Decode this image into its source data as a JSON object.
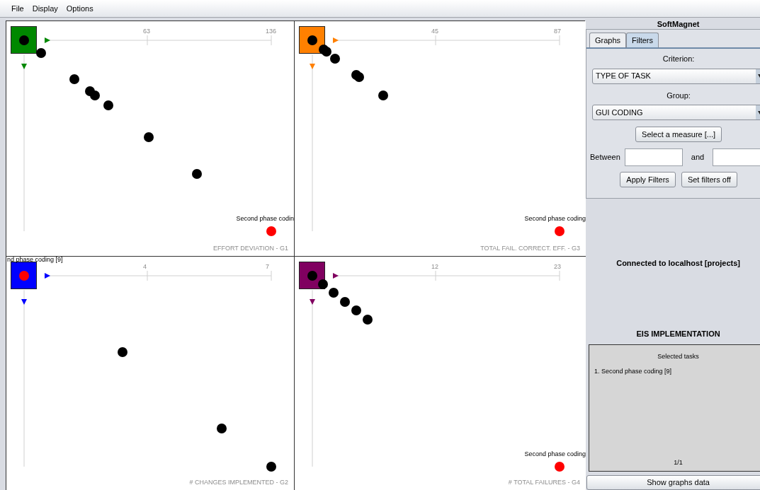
{
  "menu": [
    "File",
    "Display",
    "Options"
  ],
  "graphs": [
    {
      "title": "EFFORT DEVIATION - G1",
      "color": "#008800",
      "ticks": [
        "63",
        "136"
      ],
      "highlight_label": "Second phase codin",
      "highlight_in_square": false
    },
    {
      "title": "TOTAL FAIL. CORRECT. EFF. - G3",
      "color": "#ff8000",
      "ticks": [
        "45",
        "87"
      ],
      "highlight_label": "Second phase coding",
      "highlight_in_square": false
    },
    {
      "title": "# CHANGES IMPLEMENTED - G2",
      "color": "#0000ff",
      "ticks": [
        "4",
        "7"
      ],
      "highlight_label": "nd phase coding [9]",
      "highlight_in_square": true
    },
    {
      "title": "# TOTAL FAILURES - G4",
      "color": "#800060",
      "ticks": [
        "12",
        "23"
      ],
      "highlight_label": "Second phase coding",
      "highlight_in_square": false
    }
  ],
  "side": {
    "title": "SoftMagnet",
    "tabs": [
      {
        "label": "Graphs",
        "selected": false
      },
      {
        "label": "Filters",
        "selected": true
      }
    ],
    "criterion_label": "Criterion:",
    "criterion_value": "TYPE OF TASK",
    "group_label": "Group:",
    "group_value": "GUI CODING",
    "measure_button": "Select a measure [...]",
    "between_label": "Between",
    "and_label": "and",
    "apply_button": "Apply Filters",
    "off_button": "Set filters off",
    "connection": "Connected to localhost [projects]",
    "project": "EIS IMPLEMENTATION",
    "tasks_title": "Selected tasks",
    "tasks": [
      "1. Second phase coding [9]"
    ],
    "page": "1/1",
    "show_button": "Show graphs data"
  }
}
